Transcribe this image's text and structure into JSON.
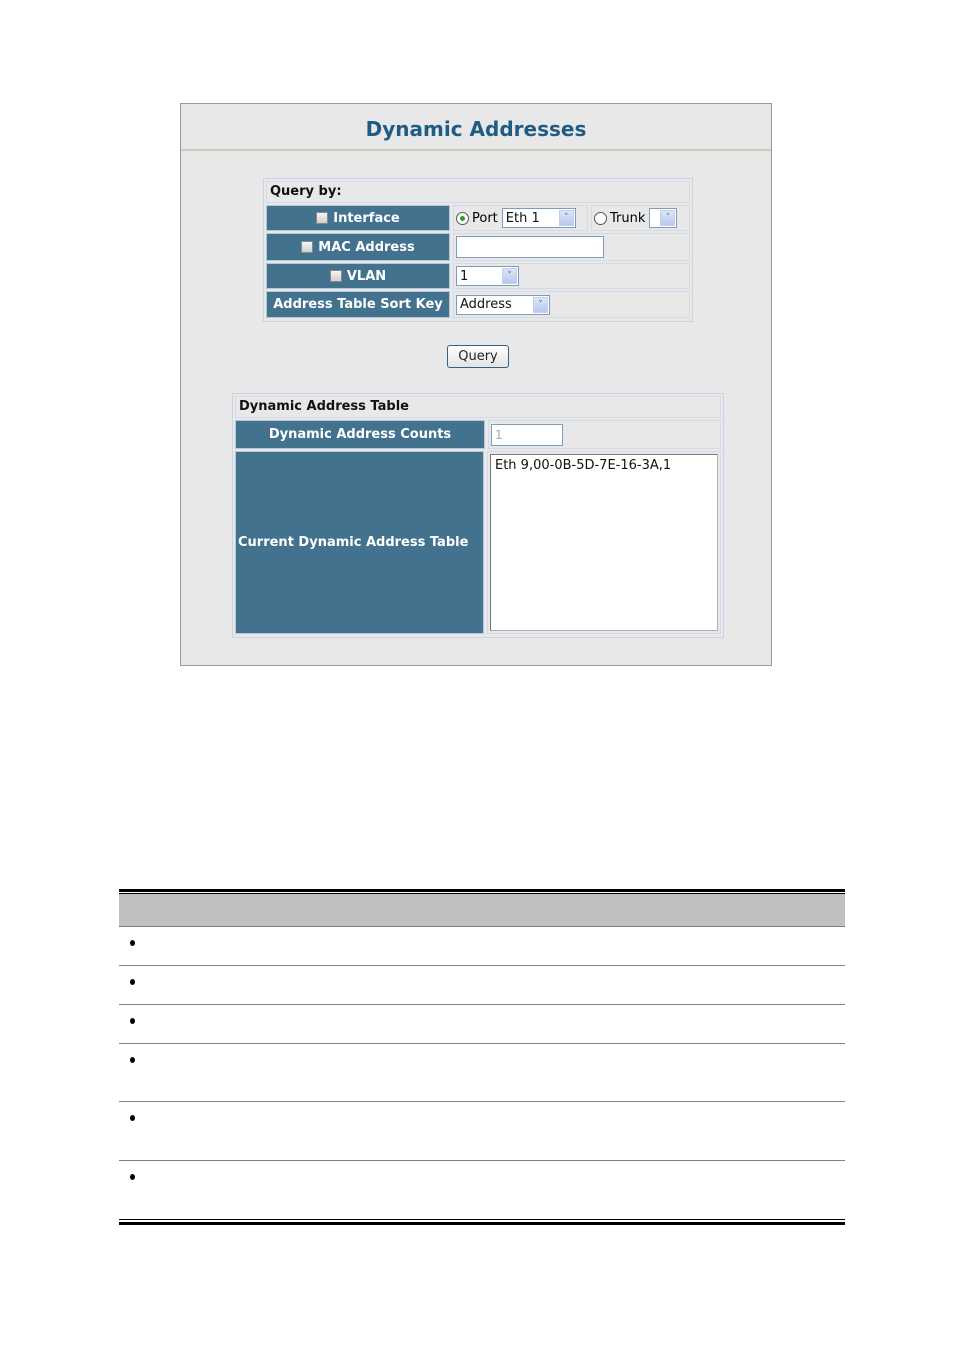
{
  "page": {
    "title": "Dynamic Addresses"
  },
  "query": {
    "caption": "Query by:",
    "interface": {
      "label": "Interface",
      "checked": false,
      "port_label": "Port",
      "port_selected": true,
      "port_value": "Eth 1",
      "trunk_label": "Trunk",
      "trunk_selected": false,
      "trunk_value": ""
    },
    "mac": {
      "label": "MAC Address",
      "checked": false,
      "value": ""
    },
    "vlan": {
      "label": "VLAN",
      "checked": false,
      "value": "1"
    },
    "sort_key": {
      "label": "Address Table Sort Key",
      "value": "Address"
    },
    "button_label": "Query"
  },
  "results": {
    "caption": "Dynamic Address Table",
    "counts_label": "Dynamic Address Counts",
    "counts_value": "1",
    "current_label": "Current Dynamic Address Table",
    "entries": [
      "Eth 9,00-0B-5D-7E-16-3A,1"
    ]
  },
  "lower_table": {
    "rows": [
      {
        "bullet": true,
        "text": ""
      },
      {
        "bullet": true,
        "text": ""
      },
      {
        "bullet": true,
        "text": ""
      },
      {
        "bullet": true,
        "text": ""
      },
      {
        "bullet": true,
        "text": ""
      },
      {
        "bullet": true,
        "text": ""
      }
    ]
  }
}
